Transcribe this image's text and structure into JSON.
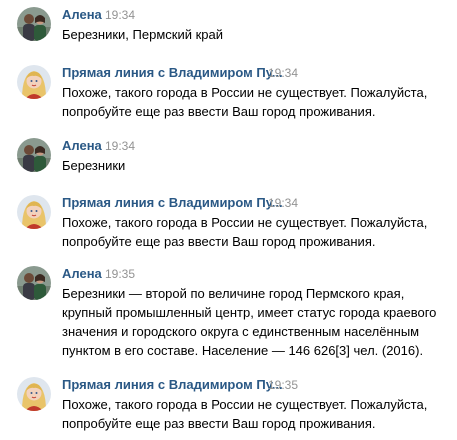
{
  "messages": [
    {
      "author": "Алена",
      "time": "19:34",
      "text": "Березники, Пермский край",
      "avatar": "couple-avatar"
    },
    {
      "author": "Прямая линия с Владимиром Пу...",
      "time": "19:34",
      "text": "Похоже, такого города в России не существует. Пожалуйста,\nпопробуйте еще раз ввести Ваш город проживания.",
      "avatar": "blonde-woman-avatar"
    },
    {
      "author": "Алена",
      "time": "19:34",
      "text": "Березники",
      "avatar": "couple-avatar"
    },
    {
      "author": "Прямая линия с Владимиром Пу...",
      "time": "19:34",
      "text": "Похоже, такого города в России не существует. Пожалуйста,\nпопробуйте еще раз ввести Ваш город проживания.",
      "avatar": "blonde-woman-avatar"
    },
    {
      "author": "Алена",
      "time": "19:35",
      "text": "Березники — второй по величине город Пермского края,\nкрупный промышленный центр, имеет статус города краевого\nзначения и городского округа с единственным населённым\nпунктом в его составе. Население — 146 626[3] чел. (2016).",
      "avatar": "couple-avatar"
    },
    {
      "author": "Прямая линия с Владимиром Пу...",
      "time": "19:35",
      "text": "Похоже, такого города в России не существует. Пожалуйста,\nпопробуйте еще раз ввести Ваш город проживания.",
      "avatar": "blonde-woman-avatar"
    }
  ],
  "colors": {
    "author": "#2a5885",
    "time": "#939393",
    "text": "#000000"
  }
}
